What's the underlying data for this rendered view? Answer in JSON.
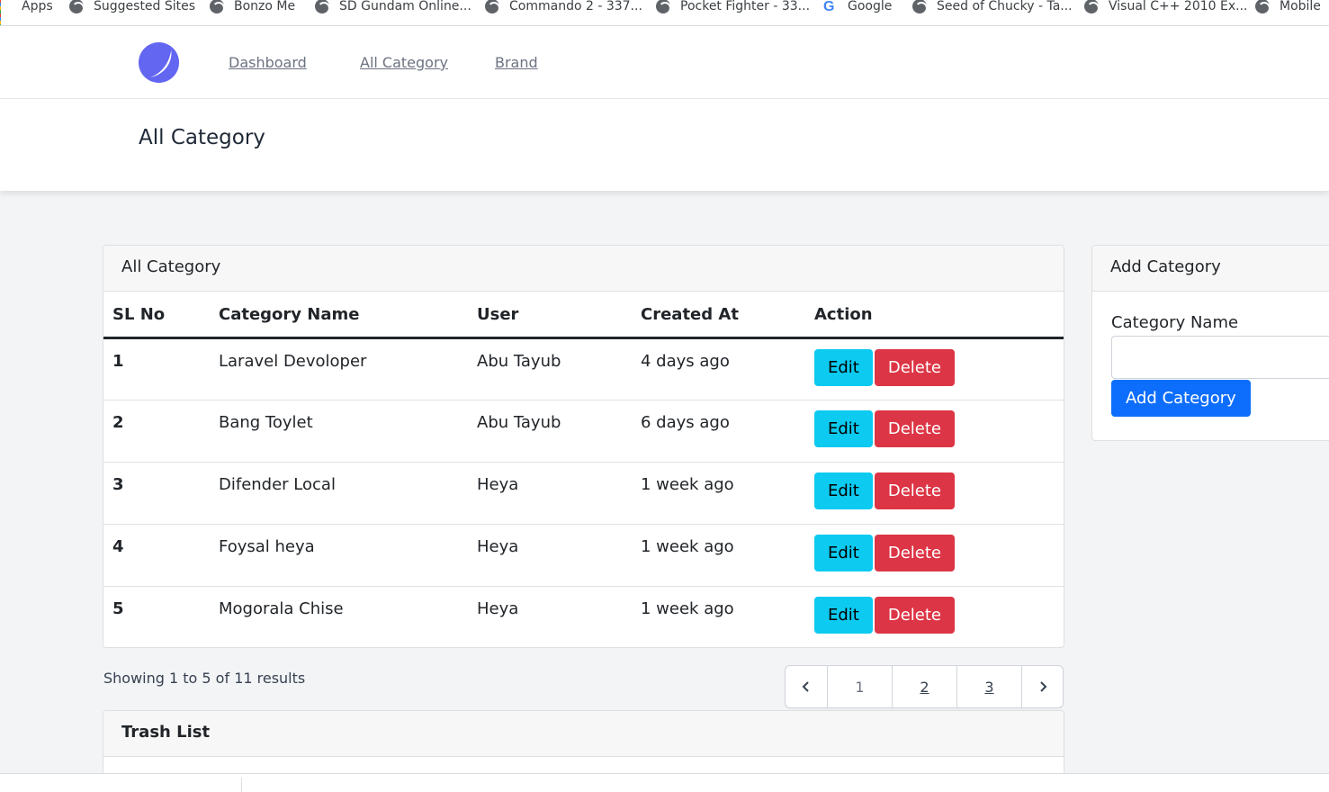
{
  "bookmarks": [
    {
      "label": "Apps",
      "icon": "apps-grid-icon"
    },
    {
      "label": "Suggested Sites",
      "icon": "globe-icon"
    },
    {
      "label": "Bonzo Me",
      "icon": "globe-icon"
    },
    {
      "label": "SD Gundam Online...",
      "icon": "globe-icon"
    },
    {
      "label": "Commando 2 - 337...",
      "icon": "globe-icon"
    },
    {
      "label": "Pocket Fighter - 33...",
      "icon": "globe-icon"
    },
    {
      "label": "Google",
      "icon": "google-icon"
    },
    {
      "label": "Seed of Chucky - Ta...",
      "icon": "globe-icon"
    },
    {
      "label": "Visual C++ 2010 Ex...",
      "icon": "globe-icon"
    },
    {
      "label": "Mobile",
      "icon": "globe-icon"
    }
  ],
  "nav": {
    "links": [
      "Dashboard",
      "All Category",
      "Brand"
    ]
  },
  "header": {
    "title": "All Category"
  },
  "category_card": {
    "title": "All Category",
    "columns": [
      "SL No",
      "Category Name",
      "User",
      "Created At",
      "Action"
    ],
    "rows": [
      {
        "sl": "1",
        "name": "Laravel Devoloper",
        "user": "Abu Tayub",
        "created": "4 days ago"
      },
      {
        "sl": "2",
        "name": "Bang Toylet",
        "user": "Abu Tayub",
        "created": "6 days ago"
      },
      {
        "sl": "3",
        "name": "Difender Local",
        "user": "Heya",
        "created": "1 week ago"
      },
      {
        "sl": "4",
        "name": "Foysal heya",
        "user": "Heya",
        "created": "1 week ago"
      },
      {
        "sl": "5",
        "name": "Mogorala Chise",
        "user": "Heya",
        "created": "1 week ago"
      }
    ],
    "edit_label": "Edit",
    "delete_label": "Delete",
    "showing": "Showing 1 to 5 of 11 results",
    "pages": [
      "1",
      "2",
      "3"
    ]
  },
  "trash_card": {
    "title": "Trash List"
  },
  "add_card": {
    "title": "Add Category",
    "field_label": "Category Name",
    "input_value": "",
    "button_label": "Add Category"
  },
  "colors": {
    "edit": "#0dcaf0",
    "delete": "#dc3545",
    "primary": "#0d6efd",
    "logo": "#6366f1"
  }
}
